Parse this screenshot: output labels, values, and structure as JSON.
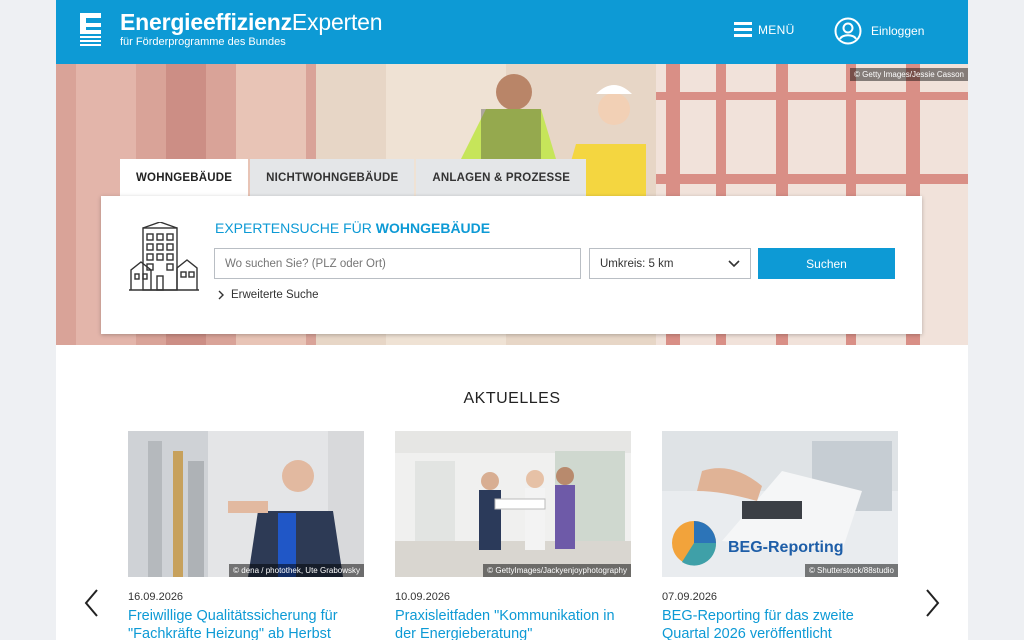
{
  "header": {
    "brand_bold": "Energieeffizienz",
    "brand_regular": "Experten",
    "brand_subtitle": "für Förderprogramme des Bundes",
    "menu_label": "MENÜ",
    "login_label": "Einloggen"
  },
  "hero": {
    "credit": "© Getty Images/Jessie Casson"
  },
  "tabs": [
    {
      "label": "WOHNGEBÄUDE",
      "active": true
    },
    {
      "label": "NICHTWOHNGEBÄUDE",
      "active": false
    },
    {
      "label": "ANLAGEN & PROZESSE",
      "active": false
    }
  ],
  "search": {
    "heading_prefix": "EXPERTENSUCHE FÜR ",
    "heading_highlight": "WOHNGEBÄUDE",
    "location_placeholder": "Wo suchen Sie? (PLZ oder Ort)",
    "radius_value": "Umkreis: 5 km",
    "submit_label": "Suchen",
    "advanced_label": "Erweiterte Suche"
  },
  "news": {
    "heading": "AKTUELLES",
    "items": [
      {
        "date": "16.09.2026",
        "title": "Freiwillige Qualitätssicherung für \"Fachkräfte Heizung\" ab Herbst",
        "credit": "© dena / photothek, Ute Grabowsky"
      },
      {
        "date": "10.09.2026",
        "title": "Praxisleitfaden \"Kommunikation in der Energieberatung\"",
        "credit": "© GettyImages/Jackyenjoyphotography"
      },
      {
        "date": "07.09.2026",
        "title": "BEG-Reporting für das zweite Quartal 2026 veröffentlicht",
        "credit": "© Shutterstock/88studio",
        "image_text": "BEG-Reporting"
      }
    ]
  },
  "colors": {
    "brand_blue": "#0d9ad5",
    "tab_inactive": "#e4e6e8"
  },
  "icons": [
    "logo-e-icon",
    "hamburger-icon",
    "user-icon",
    "house-building-icon",
    "chevron-down-icon",
    "chevron-right-icon",
    "arrow-left-icon",
    "arrow-right-icon"
  ]
}
